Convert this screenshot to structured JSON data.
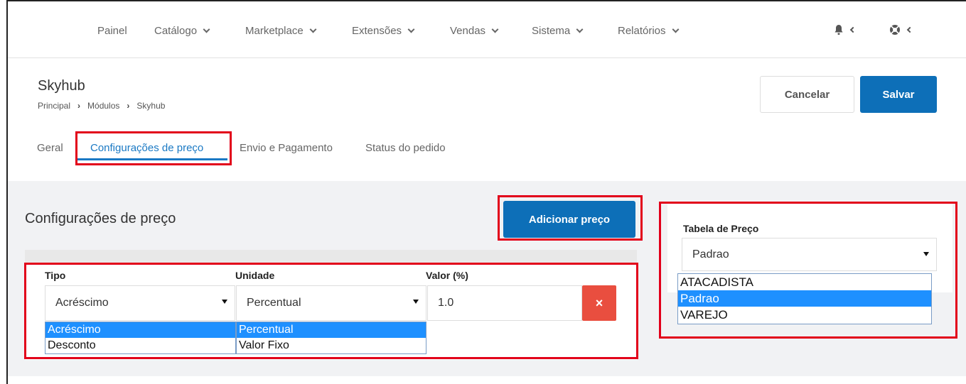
{
  "nav": {
    "items": [
      {
        "label": "Painel",
        "has_menu": false
      },
      {
        "label": "Catálogo",
        "has_menu": true
      },
      {
        "label": "Marketplace",
        "has_menu": true
      },
      {
        "label": "Extensões",
        "has_menu": true
      },
      {
        "label": "Vendas",
        "has_menu": true
      },
      {
        "label": "Sistema",
        "has_menu": true
      },
      {
        "label": "Relatórios",
        "has_menu": true
      }
    ],
    "icons": [
      "bell-icon",
      "lifebuoy-icon"
    ]
  },
  "header": {
    "title": "Skyhub",
    "breadcrumb": [
      "Principal",
      "Módulos",
      "Skyhub"
    ],
    "cancel_label": "Cancelar",
    "save_label": "Salvar"
  },
  "tabs": [
    {
      "label": "Geral",
      "active": false
    },
    {
      "label": "Configurações de preço",
      "active": true
    },
    {
      "label": "Envio e Pagamento",
      "active": false
    },
    {
      "label": "Status do pedido",
      "active": false
    }
  ],
  "pricing": {
    "section_title": "Configurações de preço",
    "add_label": "Adicionar preço",
    "columns": {
      "tipo": "Tipo",
      "unidade": "Unidade",
      "valor": "Valor (%)"
    },
    "row": {
      "tipo": "Acréscimo",
      "unidade": "Percentual",
      "valor": "1.0",
      "delete_label": "×"
    },
    "tipo_options": [
      "Acréscimo",
      "Desconto"
    ],
    "unidade_options": [
      "Percentual",
      "Valor Fixo"
    ]
  },
  "price_table": {
    "label": "Tabela de Preço",
    "selected": "Padrao",
    "options": [
      "ATACADISTA",
      "Padrao",
      "VAREJO"
    ]
  },
  "colors": {
    "primary": "#0d6fb8",
    "danger": "#e94e3f",
    "highlight": "#e2001a",
    "selection": "#1e90ff"
  }
}
